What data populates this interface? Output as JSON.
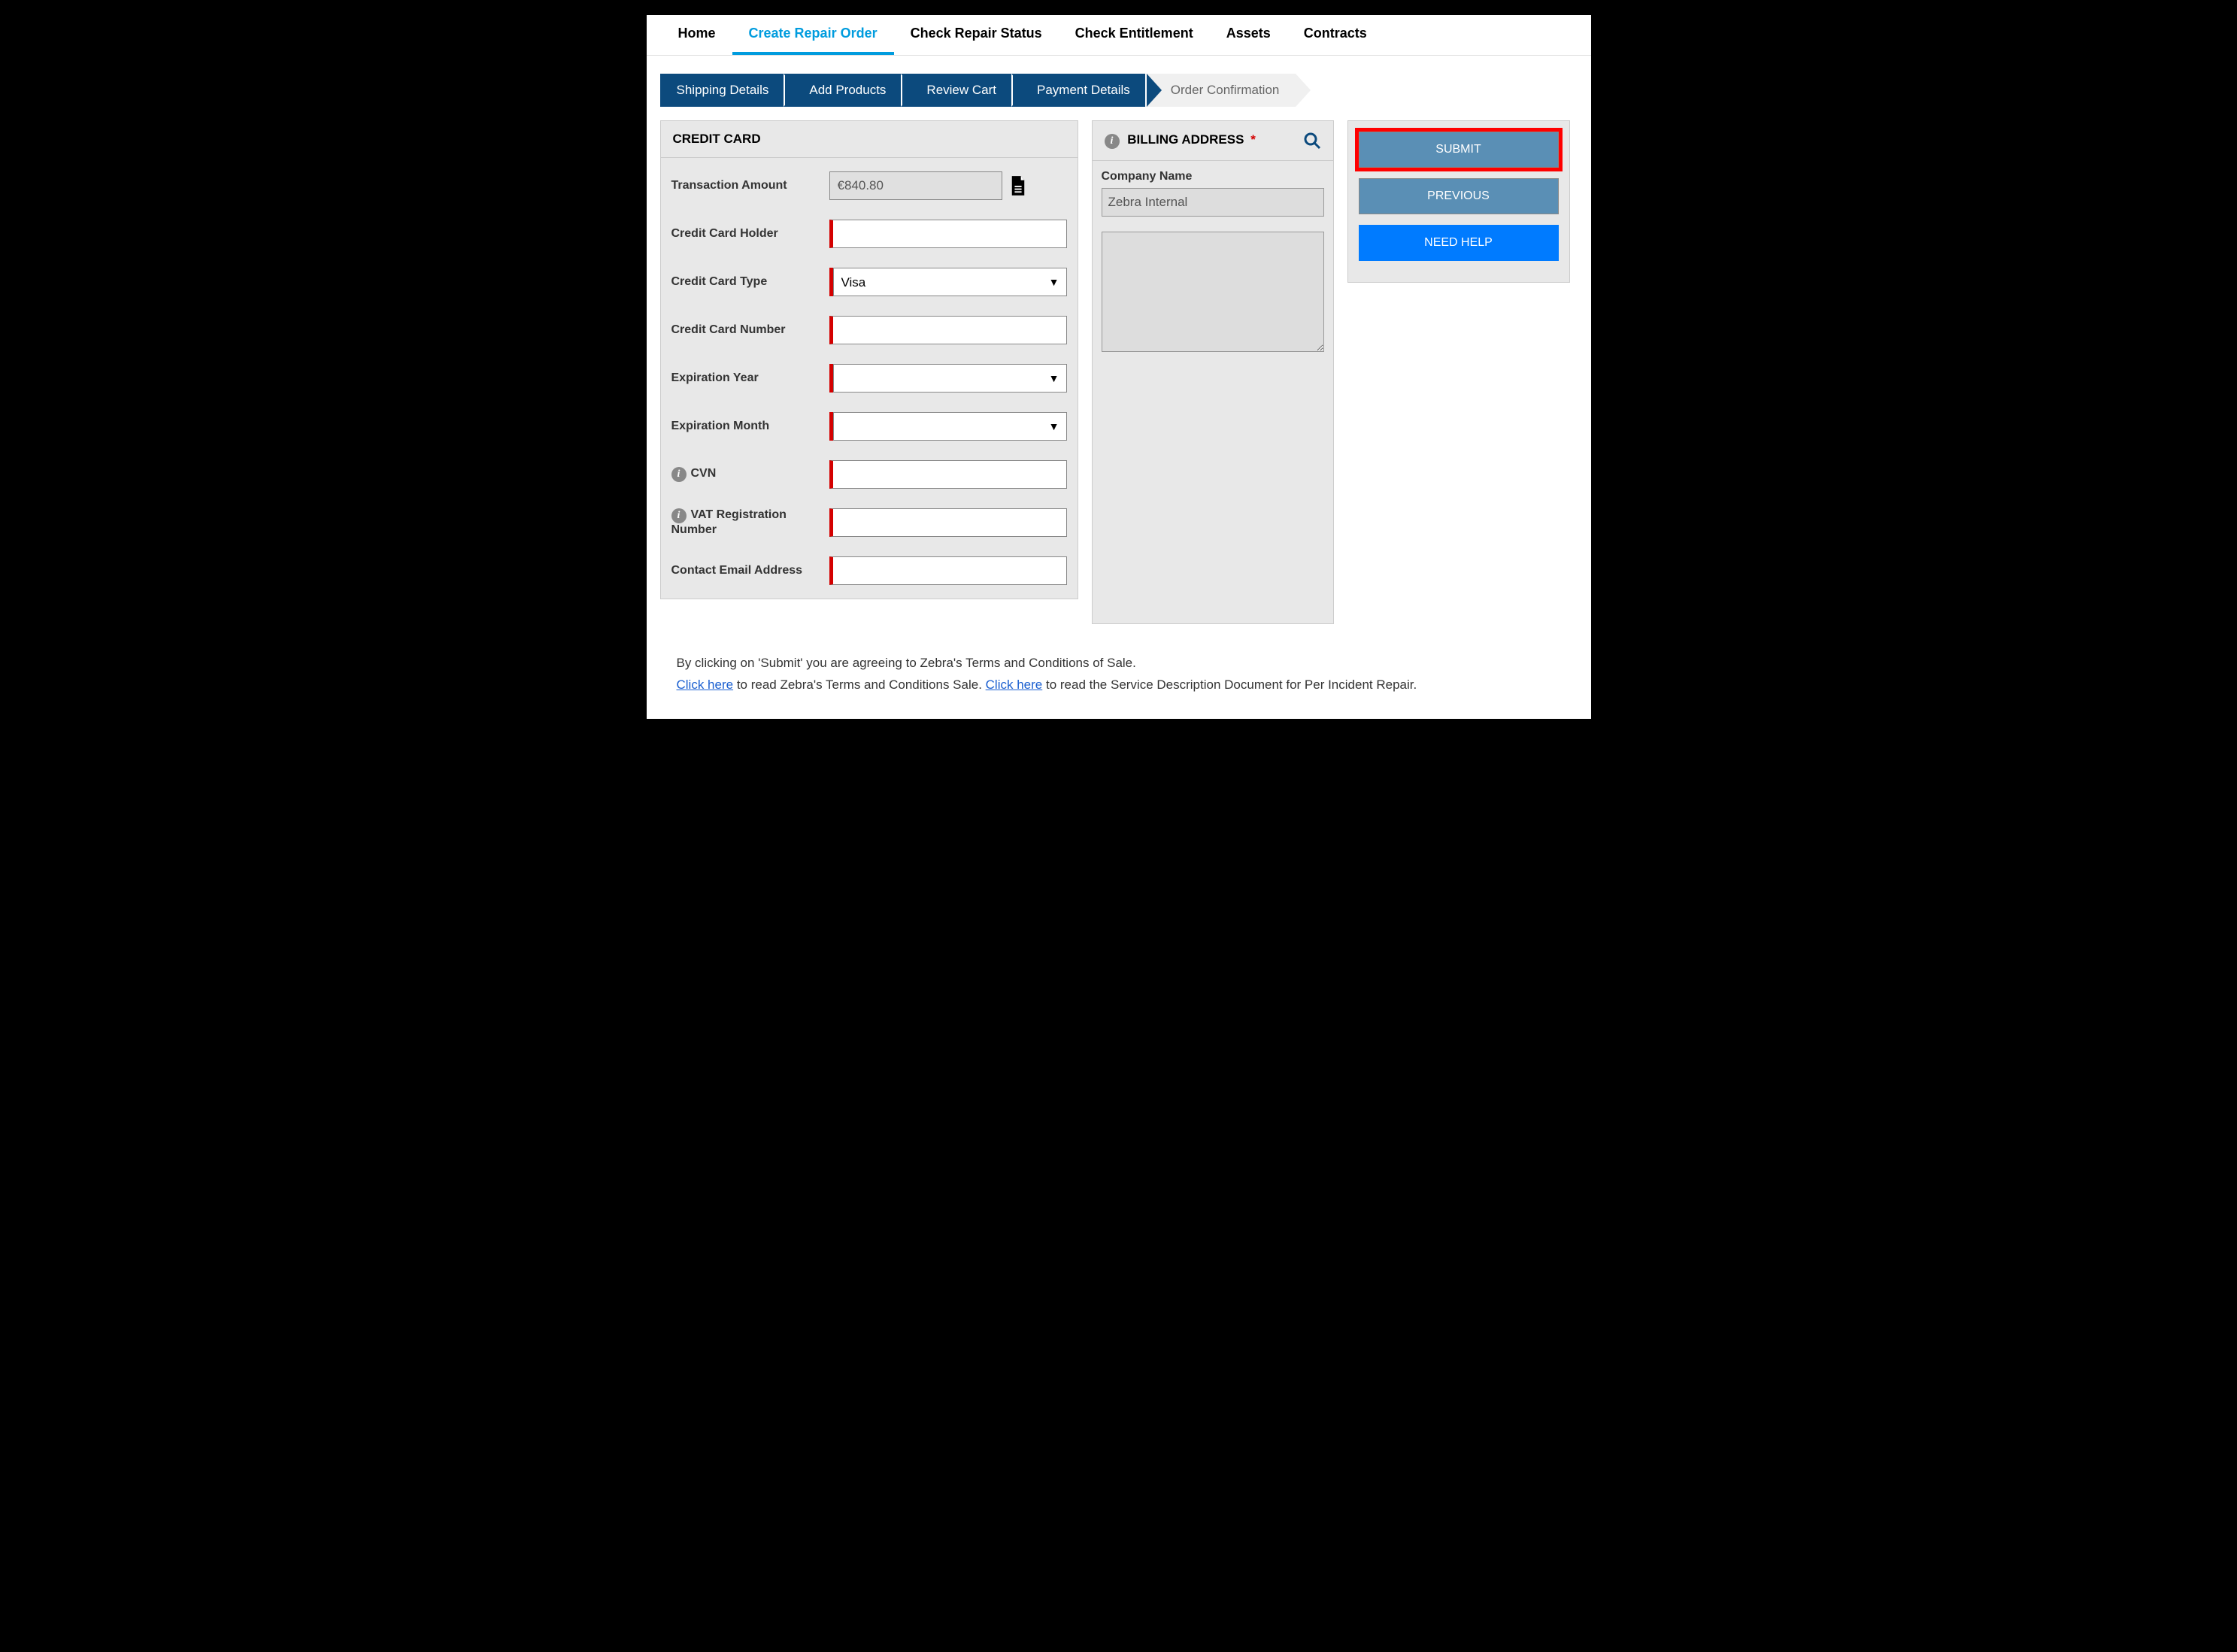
{
  "nav": {
    "items": [
      "Home",
      "Create Repair Order",
      "Check Repair Status",
      "Check Entitlement",
      "Assets",
      "Contracts"
    ],
    "active": 1
  },
  "progress": {
    "steps": [
      "Shipping Details",
      "Add Products",
      "Review Cart",
      "Payment Details",
      "Order Confirmation"
    ],
    "current": 3
  },
  "creditCard": {
    "title": "CREDIT CARD",
    "fields": {
      "transactionAmount": {
        "label": "Transaction Amount",
        "value": "€840.80"
      },
      "holder": {
        "label": "Credit Card Holder",
        "value": ""
      },
      "type": {
        "label": "Credit Card Type",
        "value": "Visa"
      },
      "number": {
        "label": "Credit Card Number",
        "value": ""
      },
      "expYear": {
        "label": "Expiration Year",
        "value": ""
      },
      "expMonth": {
        "label": "Expiration Month",
        "value": ""
      },
      "cvn": {
        "label": "CVN",
        "value": ""
      },
      "vat": {
        "label": "VAT Registration Number",
        "value": ""
      },
      "email": {
        "label": "Contact Email Address",
        "value": ""
      }
    }
  },
  "billing": {
    "title": "BILLING ADDRESS",
    "companyLabel": "Company Name",
    "companyValue": "Zebra Internal"
  },
  "actions": {
    "submit": "SUBMIT",
    "previous": "PREVIOUS",
    "help": "NEED HELP"
  },
  "footer": {
    "line1": "By clicking on 'Submit' you are agreeing to Zebra's Terms and Conditions of Sale.",
    "link1": "Click here",
    "mid1": " to read Zebra's Terms and Conditions Sale. ",
    "link2": "Click here",
    "mid2": " to read the Service Description Document for Per Incident Repair."
  }
}
